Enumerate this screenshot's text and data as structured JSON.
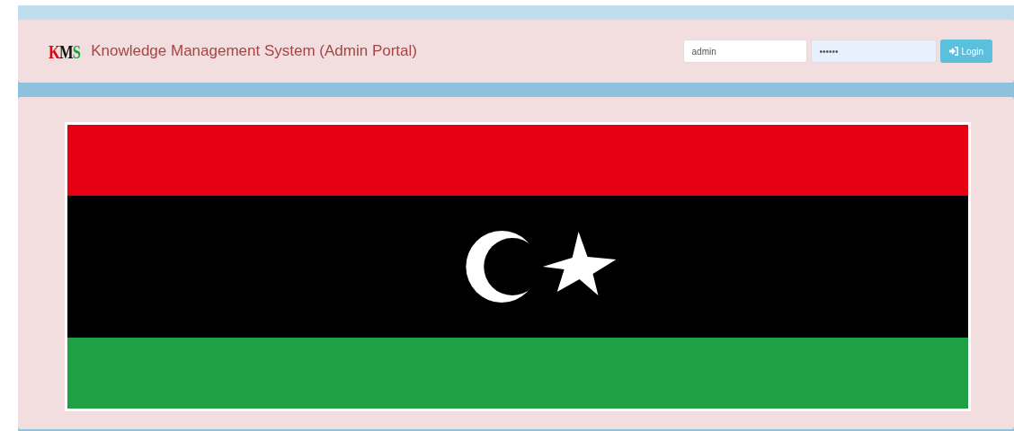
{
  "header": {
    "logo": [
      {
        "text": "K",
        "color": "#e00010"
      },
      {
        "text": "M",
        "color": "#111111"
      },
      {
        "text": "S",
        "color": "#1fa046"
      }
    ],
    "title": "Knowledge Management System (Admin Portal)"
  },
  "login": {
    "username": "admin",
    "password": "••••••",
    "button": "Login"
  },
  "banner": {
    "kind": "flag"
  }
}
